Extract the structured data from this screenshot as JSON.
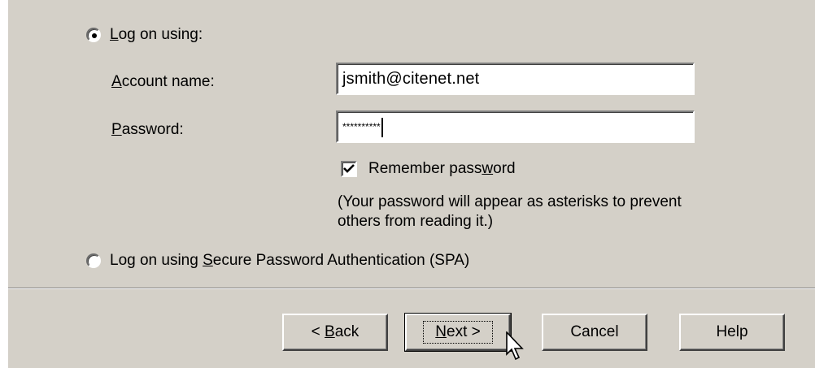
{
  "logon": {
    "option_label": "Log on using:",
    "option_selected": true,
    "account_label": "Account name:",
    "account_value": "jsmith@citenet.net",
    "password_label": "Password:",
    "password_value": "**********",
    "remember_label": "Remember password",
    "remember_checked": true,
    "note_line1": "(Your password will appear as asterisks to prevent",
    "note_line2": "others from reading it.)",
    "spa_label": "Log on using Secure Password Authentication (SPA)",
    "spa_selected": false
  },
  "buttons": {
    "back": "< Back",
    "next": "Next >",
    "cancel": "Cancel",
    "help": "Help"
  },
  "colors": {
    "dialog_face": "#d4d0c8",
    "field_background": "#ffffff"
  },
  "icons": {
    "cursor": "mouse-pointer-icon",
    "check": "checkmark-icon"
  }
}
